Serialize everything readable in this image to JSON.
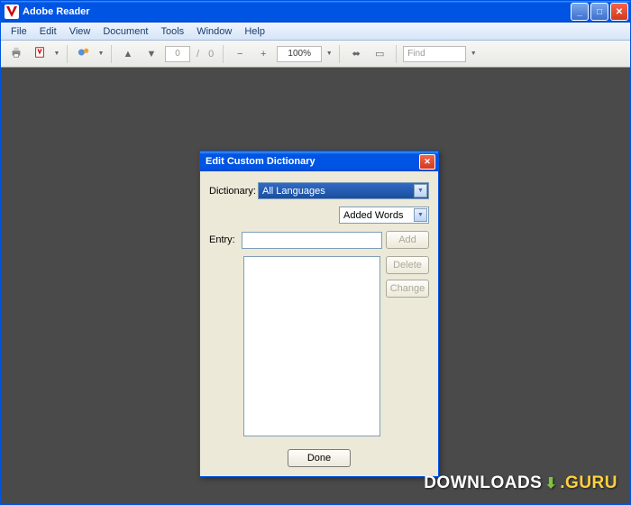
{
  "window": {
    "title": "Adobe Reader"
  },
  "menu": {
    "items": [
      "File",
      "Edit",
      "View",
      "Document",
      "Tools",
      "Window",
      "Help"
    ]
  },
  "toolbar": {
    "page_current": "0",
    "page_sep": "/",
    "page_total": "0",
    "zoom": "100%",
    "find_placeholder": "Find"
  },
  "dialog": {
    "title": "Edit Custom Dictionary",
    "dictionary_label": "Dictionary:",
    "dictionary_value": "All Languages",
    "filter_value": "Added Words",
    "entry_label": "Entry:",
    "entry_value": "",
    "buttons": {
      "add": "Add",
      "delete": "Delete",
      "change": "Change",
      "done": "Done"
    }
  },
  "watermark": {
    "text1": "DOWNLOADS",
    "text2": ".GURU"
  }
}
